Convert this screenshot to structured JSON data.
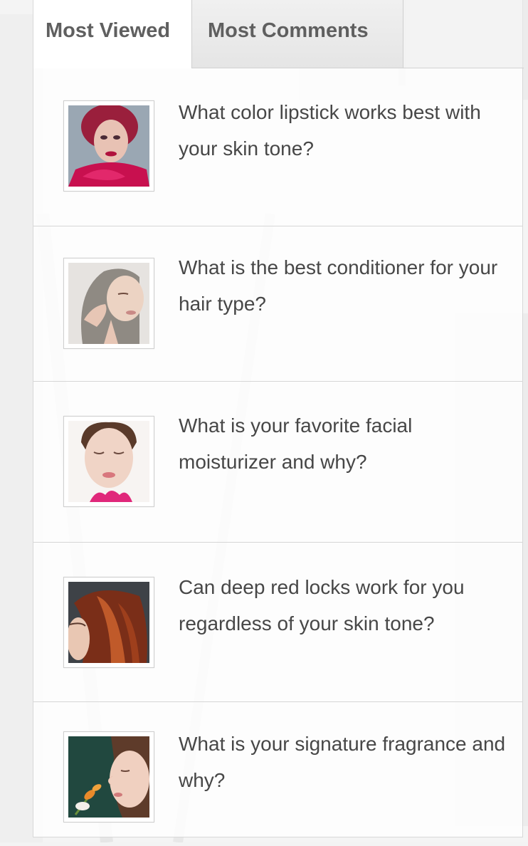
{
  "tabs": [
    {
      "label": "Most Viewed",
      "active": true
    },
    {
      "label": "Most Comments",
      "active": false
    }
  ],
  "items": [
    {
      "title": "What color lipstick works best with your skin tone?",
      "image_icon": "woman-red-hair-portrait"
    },
    {
      "title": "What is the best conditioner for your hair type?",
      "image_icon": "woman-touching-hair-portrait"
    },
    {
      "title": "What is your favorite facial moisturizer and why?",
      "image_icon": "woman-face-moisturizer-portrait"
    },
    {
      "title": "Can deep red locks work for you regardless of your skin tone?",
      "image_icon": "woman-red-locks-portrait"
    },
    {
      "title": "What is your signature fragrance and why?",
      "image_icon": "woman-smelling-flower-portrait"
    }
  ],
  "colors": {
    "tab_text": "#5f5f5f",
    "item_text": "#474747",
    "divider": "#d6d6d6",
    "border": "#d8d8d8"
  }
}
